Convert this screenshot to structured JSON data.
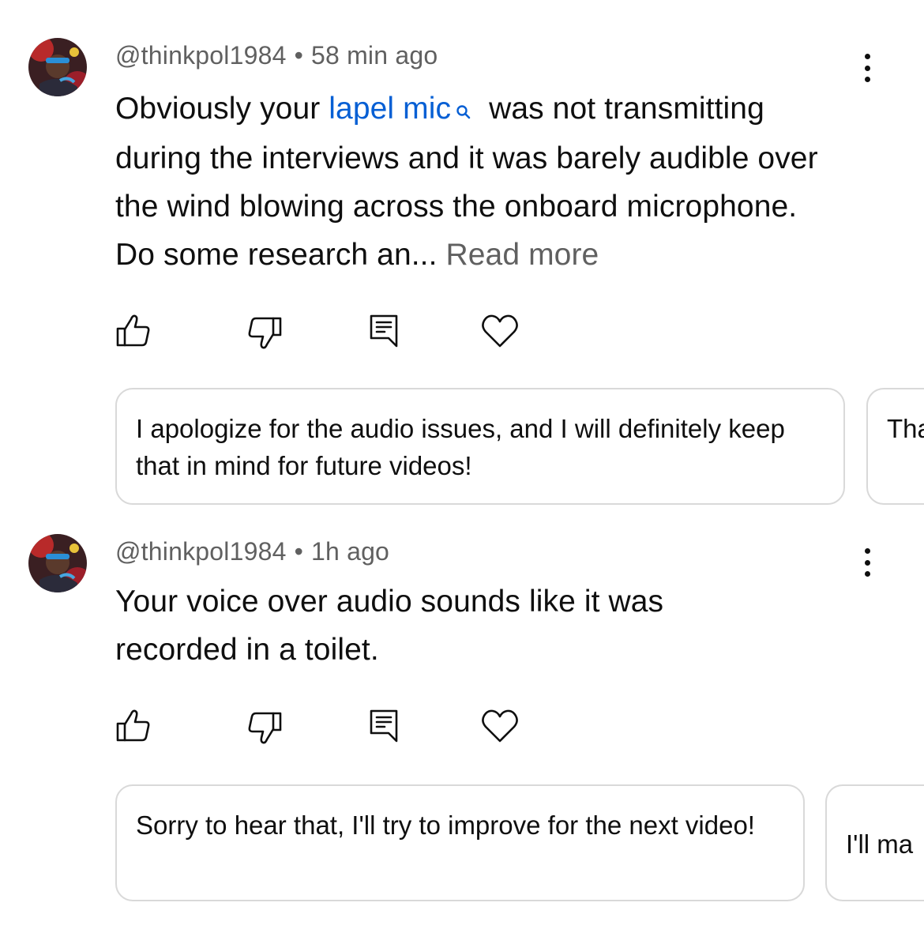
{
  "comments": [
    {
      "author": "@thinkpol1984",
      "separator": "•",
      "time": "58 min ago",
      "text_before": "Obviously your",
      "link_text": "lapel mic",
      "text_after": "was not transmitting during the interviews and it was barely audible over the wind blowing across the onboard microphone. Do some research an...",
      "read_more": "Read more",
      "suggested_replies": [
        "I apologize for the audio issues, and I will definitely keep that in mind for future videos!",
        "Tha for"
      ]
    },
    {
      "author": "@thinkpol1984",
      "separator": "•",
      "time": "1h ago",
      "text": "Your voice over audio sounds like it was recorded in a toilet.",
      "suggested_replies": [
        "Sorry to hear that, I'll try to improve for the next video!",
        "I'll ma"
      ]
    }
  ],
  "icons": {
    "like": "thumbs-up-icon",
    "dislike": "thumbs-down-icon",
    "reply": "comment-reply-icon",
    "heart": "heart-icon",
    "more": "more-vertical-icon",
    "search": "search-icon"
  },
  "colors": {
    "link": "#065fd4",
    "meta": "#606060",
    "text": "#0f0f0f",
    "card_border": "#d9d9d9"
  }
}
